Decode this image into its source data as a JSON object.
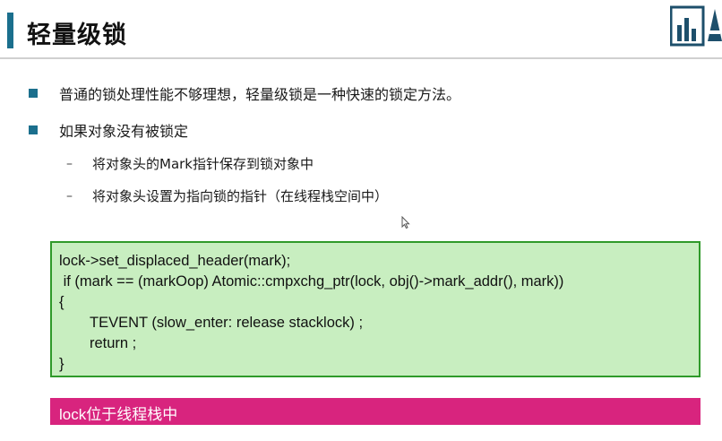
{
  "header": {
    "title": "轻量级锁"
  },
  "bullets": [
    {
      "text": "普通的锁处理性能不够理想，轻量级锁是一种快速的锁定方法。"
    },
    {
      "text": "如果对象没有被锁定"
    }
  ],
  "sub_bullets": [
    {
      "dash": "–",
      "text": "将对象头的Mark指针保存到锁对象中"
    },
    {
      "dash": "–",
      "text": "将对象头设置为指向锁的指针（在线程栈空间中）"
    }
  ],
  "code": {
    "lines": [
      "lock->set_displaced_header(mark);",
      " if (mark == (markOop) Atomic::cmpxchg_ptr(lock, obj()->mark_addr(), mark))",
      "{",
      "TEVENT (slow_enter: release stacklock) ;",
      "return ;",
      "}"
    ]
  },
  "note": {
    "text": "lock位于线程栈中"
  },
  "colors": {
    "accent": "#1b6f8d",
    "code_bg": "#c8eec0",
    "code_border": "#2f9a2a",
    "note_bg": "#d8247e"
  },
  "icons": {
    "logo": "bar-chart-logo",
    "cursor": "mouse-pointer-icon"
  }
}
